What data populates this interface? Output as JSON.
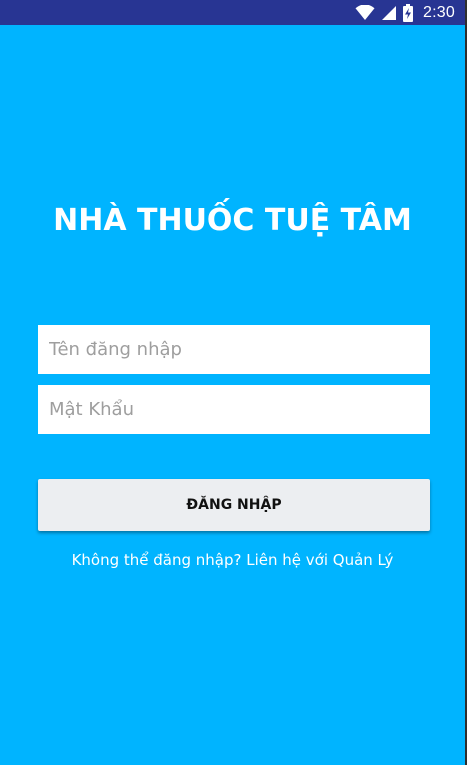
{
  "status_bar": {
    "time": "2:30",
    "icons": [
      "wifi-icon",
      "cell-signal-icon",
      "battery-charging-icon"
    ],
    "background": "#283593"
  },
  "screen": {
    "background": "#00b4ff"
  },
  "app": {
    "title": "NHÀ THUỐC TUỆ TÂM"
  },
  "login_form": {
    "username_placeholder": "Tên đăng nhập",
    "username_value": "",
    "password_placeholder": "Mật Khẩu",
    "password_value": "",
    "login_label": "ĐĂNG NHẬP",
    "help_text": "Không thể đăng nhập? Liên hệ với Quản Lý"
  }
}
